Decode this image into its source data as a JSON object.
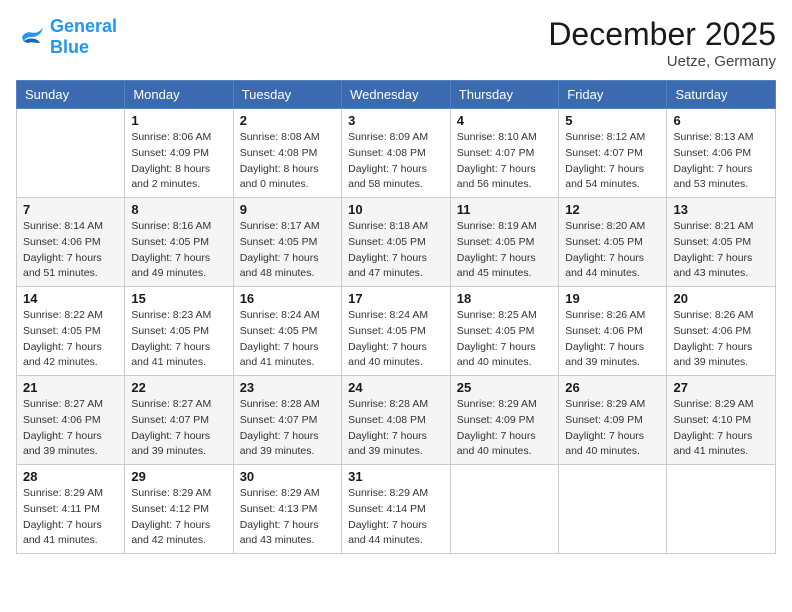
{
  "header": {
    "logo_text_general": "General",
    "logo_text_blue": "Blue",
    "month_title": "December 2025",
    "location": "Uetze, Germany"
  },
  "weekdays": [
    "Sunday",
    "Monday",
    "Tuesday",
    "Wednesday",
    "Thursday",
    "Friday",
    "Saturday"
  ],
  "weeks": [
    [
      {
        "day": "",
        "info": ""
      },
      {
        "day": "1",
        "info": "Sunrise: 8:06 AM\nSunset: 4:09 PM\nDaylight: 8 hours\nand 2 minutes."
      },
      {
        "day": "2",
        "info": "Sunrise: 8:08 AM\nSunset: 4:08 PM\nDaylight: 8 hours\nand 0 minutes."
      },
      {
        "day": "3",
        "info": "Sunrise: 8:09 AM\nSunset: 4:08 PM\nDaylight: 7 hours\nand 58 minutes."
      },
      {
        "day": "4",
        "info": "Sunrise: 8:10 AM\nSunset: 4:07 PM\nDaylight: 7 hours\nand 56 minutes."
      },
      {
        "day": "5",
        "info": "Sunrise: 8:12 AM\nSunset: 4:07 PM\nDaylight: 7 hours\nand 54 minutes."
      },
      {
        "day": "6",
        "info": "Sunrise: 8:13 AM\nSunset: 4:06 PM\nDaylight: 7 hours\nand 53 minutes."
      }
    ],
    [
      {
        "day": "7",
        "info": "Sunrise: 8:14 AM\nSunset: 4:06 PM\nDaylight: 7 hours\nand 51 minutes."
      },
      {
        "day": "8",
        "info": "Sunrise: 8:16 AM\nSunset: 4:05 PM\nDaylight: 7 hours\nand 49 minutes."
      },
      {
        "day": "9",
        "info": "Sunrise: 8:17 AM\nSunset: 4:05 PM\nDaylight: 7 hours\nand 48 minutes."
      },
      {
        "day": "10",
        "info": "Sunrise: 8:18 AM\nSunset: 4:05 PM\nDaylight: 7 hours\nand 47 minutes."
      },
      {
        "day": "11",
        "info": "Sunrise: 8:19 AM\nSunset: 4:05 PM\nDaylight: 7 hours\nand 45 minutes."
      },
      {
        "day": "12",
        "info": "Sunrise: 8:20 AM\nSunset: 4:05 PM\nDaylight: 7 hours\nand 44 minutes."
      },
      {
        "day": "13",
        "info": "Sunrise: 8:21 AM\nSunset: 4:05 PM\nDaylight: 7 hours\nand 43 minutes."
      }
    ],
    [
      {
        "day": "14",
        "info": "Sunrise: 8:22 AM\nSunset: 4:05 PM\nDaylight: 7 hours\nand 42 minutes."
      },
      {
        "day": "15",
        "info": "Sunrise: 8:23 AM\nSunset: 4:05 PM\nDaylight: 7 hours\nand 41 minutes."
      },
      {
        "day": "16",
        "info": "Sunrise: 8:24 AM\nSunset: 4:05 PM\nDaylight: 7 hours\nand 41 minutes."
      },
      {
        "day": "17",
        "info": "Sunrise: 8:24 AM\nSunset: 4:05 PM\nDaylight: 7 hours\nand 40 minutes."
      },
      {
        "day": "18",
        "info": "Sunrise: 8:25 AM\nSunset: 4:05 PM\nDaylight: 7 hours\nand 40 minutes."
      },
      {
        "day": "19",
        "info": "Sunrise: 8:26 AM\nSunset: 4:06 PM\nDaylight: 7 hours\nand 39 minutes."
      },
      {
        "day": "20",
        "info": "Sunrise: 8:26 AM\nSunset: 4:06 PM\nDaylight: 7 hours\nand 39 minutes."
      }
    ],
    [
      {
        "day": "21",
        "info": "Sunrise: 8:27 AM\nSunset: 4:06 PM\nDaylight: 7 hours\nand 39 minutes."
      },
      {
        "day": "22",
        "info": "Sunrise: 8:27 AM\nSunset: 4:07 PM\nDaylight: 7 hours\nand 39 minutes."
      },
      {
        "day": "23",
        "info": "Sunrise: 8:28 AM\nSunset: 4:07 PM\nDaylight: 7 hours\nand 39 minutes."
      },
      {
        "day": "24",
        "info": "Sunrise: 8:28 AM\nSunset: 4:08 PM\nDaylight: 7 hours\nand 39 minutes."
      },
      {
        "day": "25",
        "info": "Sunrise: 8:29 AM\nSunset: 4:09 PM\nDaylight: 7 hours\nand 40 minutes."
      },
      {
        "day": "26",
        "info": "Sunrise: 8:29 AM\nSunset: 4:09 PM\nDaylight: 7 hours\nand 40 minutes."
      },
      {
        "day": "27",
        "info": "Sunrise: 8:29 AM\nSunset: 4:10 PM\nDaylight: 7 hours\nand 41 minutes."
      }
    ],
    [
      {
        "day": "28",
        "info": "Sunrise: 8:29 AM\nSunset: 4:11 PM\nDaylight: 7 hours\nand 41 minutes."
      },
      {
        "day": "29",
        "info": "Sunrise: 8:29 AM\nSunset: 4:12 PM\nDaylight: 7 hours\nand 42 minutes."
      },
      {
        "day": "30",
        "info": "Sunrise: 8:29 AM\nSunset: 4:13 PM\nDaylight: 7 hours\nand 43 minutes."
      },
      {
        "day": "31",
        "info": "Sunrise: 8:29 AM\nSunset: 4:14 PM\nDaylight: 7 hours\nand 44 minutes."
      },
      {
        "day": "",
        "info": ""
      },
      {
        "day": "",
        "info": ""
      },
      {
        "day": "",
        "info": ""
      }
    ]
  ]
}
